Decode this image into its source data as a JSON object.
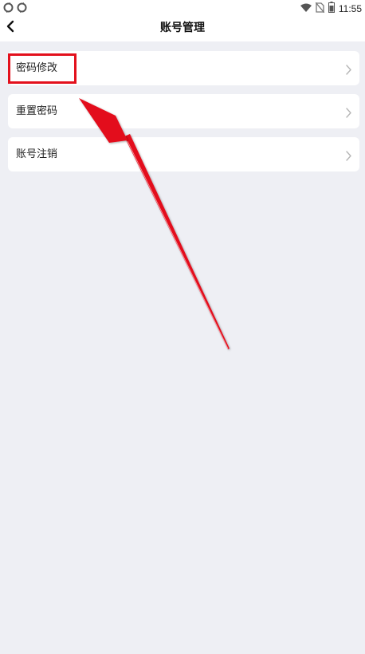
{
  "status_bar": {
    "time": "11:55",
    "left_icons": [
      "sync-icon",
      "sync-icon"
    ],
    "right_icons": [
      "wifi-icon",
      "no-sim-icon",
      "battery-icon"
    ]
  },
  "header": {
    "title": "账号管理",
    "back_icon": "chevron-left-icon"
  },
  "menu": {
    "items": [
      {
        "label": "密码修改",
        "icon": "chevron-right-icon"
      },
      {
        "label": "重置密码",
        "icon": "chevron-right-icon"
      },
      {
        "label": "账号注销",
        "icon": "chevron-right-icon"
      }
    ]
  },
  "annotation": {
    "highlight_color": "#e3101c",
    "highlighted_item": "密码修改"
  },
  "colors": {
    "background": "#eeeff4",
    "card": "#ffffff",
    "accent": "#e3101c"
  }
}
